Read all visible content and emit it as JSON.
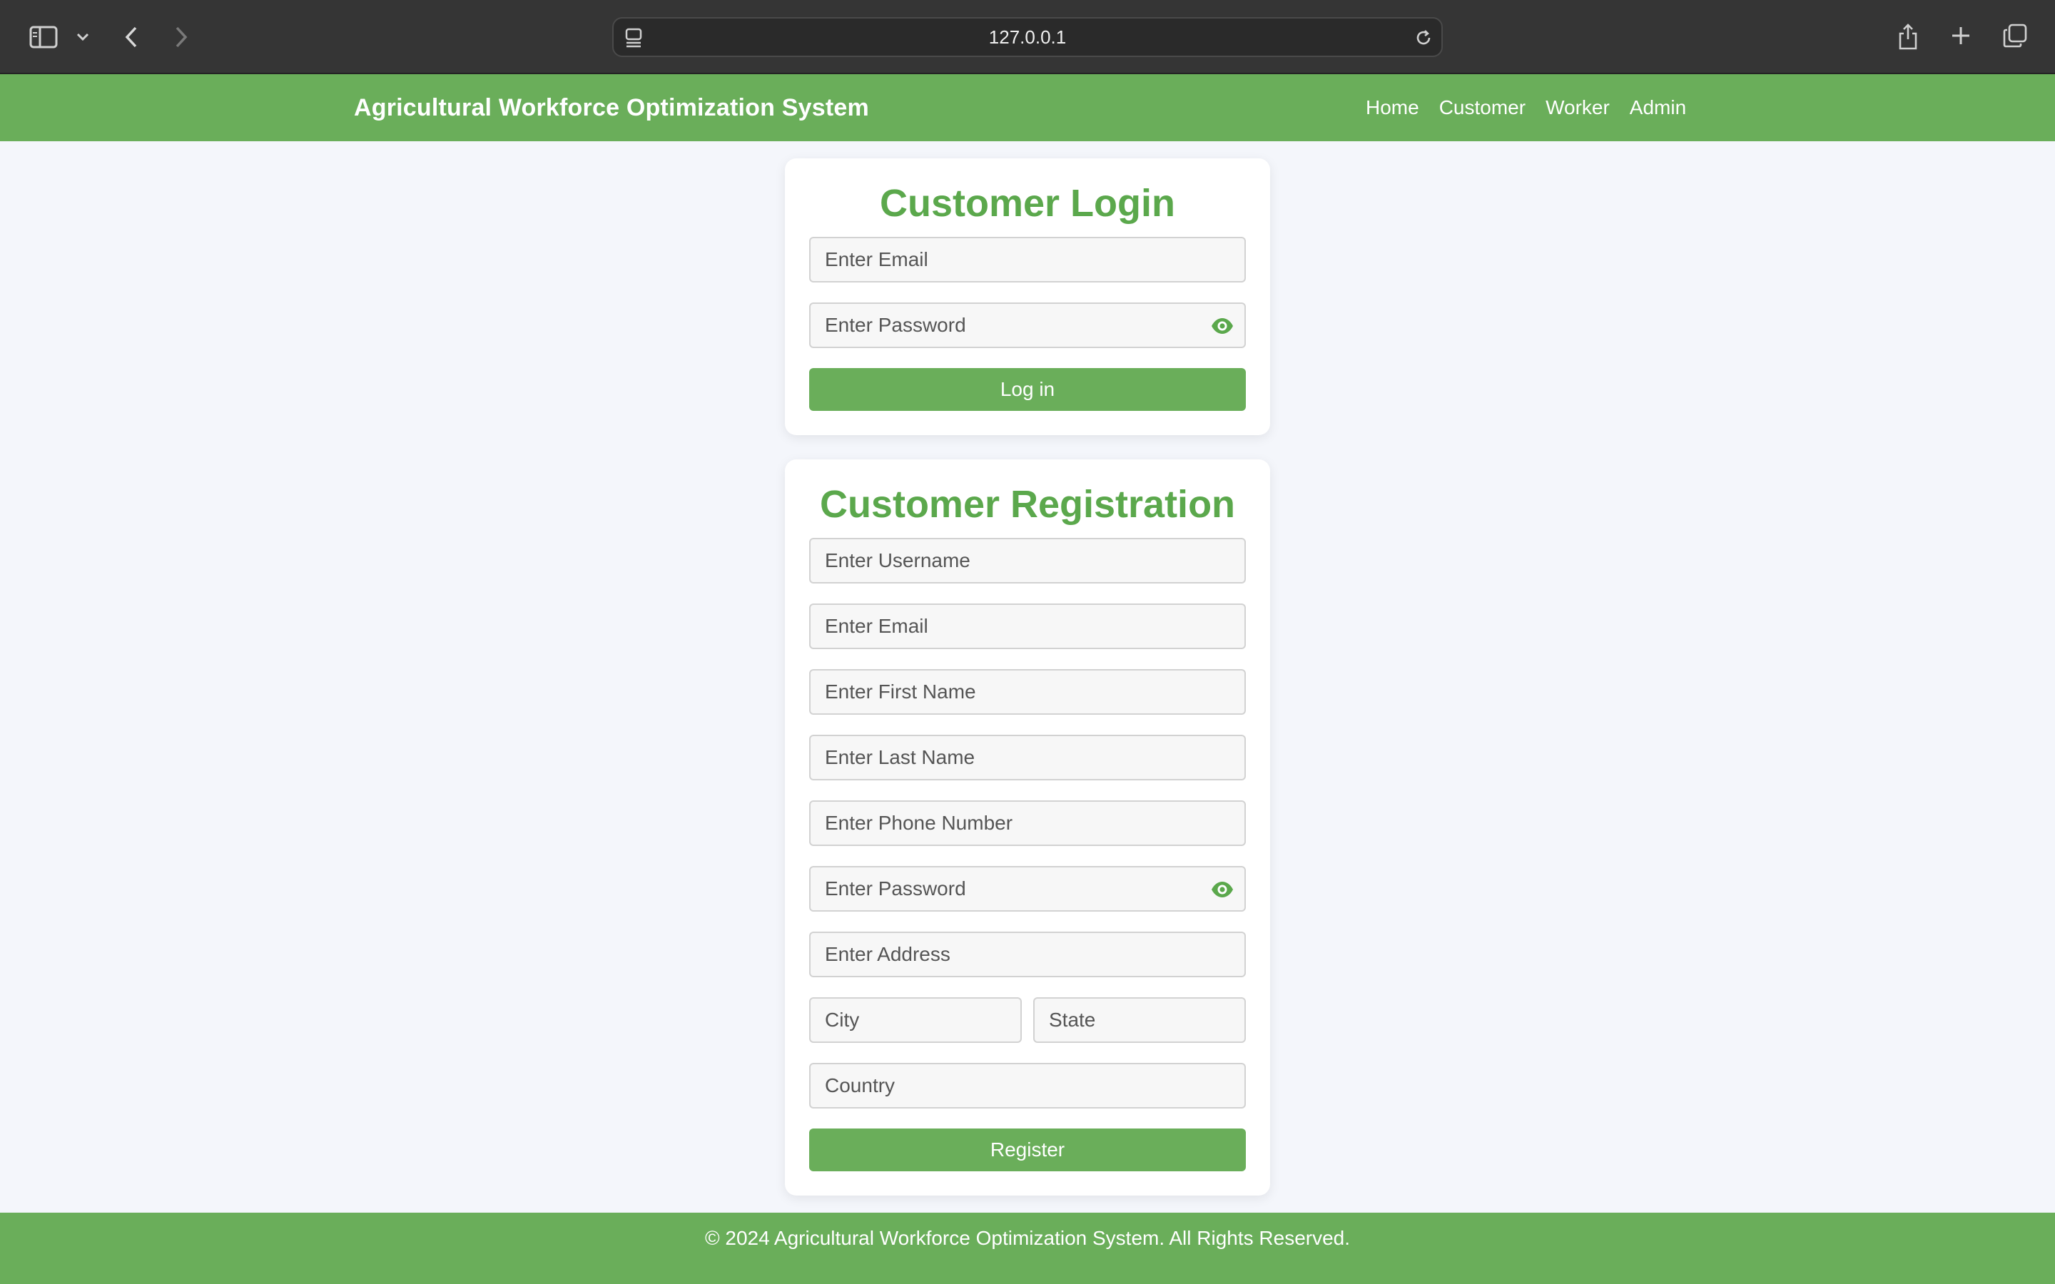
{
  "browser": {
    "url": "127.0.0.1",
    "icons": [
      "sidebar-icon",
      "chevron-down-icon",
      "back-icon",
      "forward-icon",
      "page-icon",
      "reload-icon",
      "share-icon",
      "new-tab-icon",
      "tabs-overview-icon"
    ]
  },
  "header": {
    "brand": "Agricultural Workforce Optimization System",
    "nav": [
      "Home",
      "Customer",
      "Worker",
      "Admin"
    ]
  },
  "login": {
    "title": "Customer Login",
    "email_placeholder": "Enter Email",
    "password_placeholder": "Enter Password",
    "button": "Log in"
  },
  "registration": {
    "title": "Customer Registration",
    "username_placeholder": "Enter Username",
    "email_placeholder": "Enter Email",
    "first_name_placeholder": "Enter First Name",
    "last_name_placeholder": "Enter Last Name",
    "phone_placeholder": "Enter Phone Number",
    "password_placeholder": "Enter Password",
    "address_placeholder": "Enter Address",
    "city_placeholder": "City",
    "state_placeholder": "State",
    "country_placeholder": "Country",
    "button": "Register"
  },
  "footer": {
    "text": "© 2024 Agricultural Workforce Optimization System. All Rights Reserved."
  },
  "colors": {
    "brand_green": "#6aae5a",
    "title_green": "#5ba84c",
    "page_bg": "#f4f6fb",
    "browser_bar": "#353535"
  }
}
